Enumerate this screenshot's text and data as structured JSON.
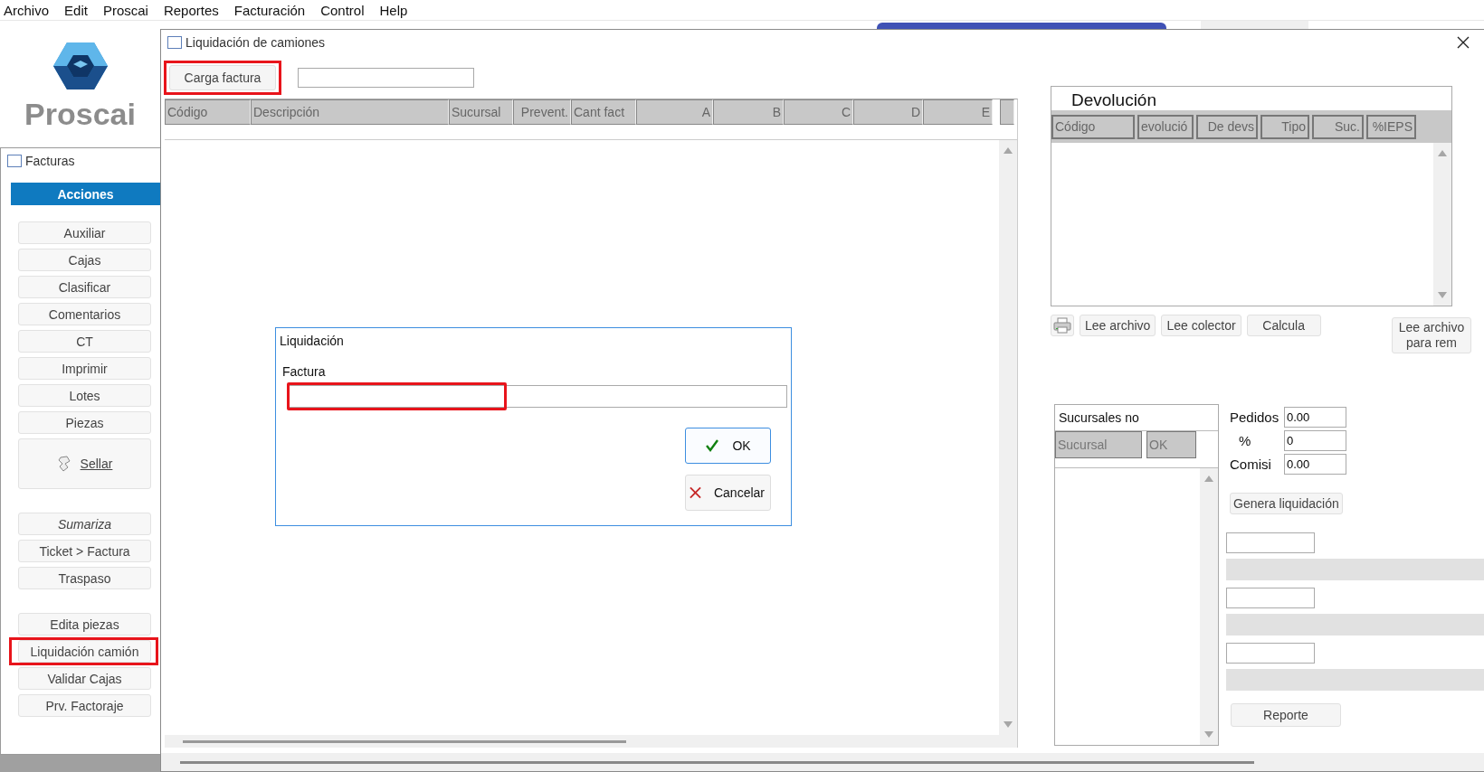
{
  "menu": [
    "Archivo",
    "Edit",
    "Proscai",
    "Reportes",
    "Facturación",
    "Control",
    "Help"
  ],
  "logo": {
    "text": "Proscai"
  },
  "sidebar": {
    "title": "Facturas",
    "section": "Acciones",
    "groups": [
      [
        {
          "label": "Auxiliar",
          "kind": "plain",
          "highlighted": false
        },
        {
          "label": "Cajas",
          "kind": "plain",
          "highlighted": false
        },
        {
          "label": "Clasificar",
          "kind": "plain",
          "highlighted": false
        },
        {
          "label": "Comentarios",
          "kind": "plain",
          "highlighted": false
        },
        {
          "label": "CT",
          "kind": "plain",
          "highlighted": false
        },
        {
          "label": "Imprimir",
          "kind": "plain",
          "highlighted": false
        },
        {
          "label": "Lotes",
          "kind": "plain",
          "highlighted": false
        },
        {
          "label": "Piezas",
          "kind": "plain",
          "highlighted": false
        },
        {
          "label": "Sellar",
          "kind": "tall",
          "highlighted": false
        }
      ],
      [
        {
          "label": "Sumariza",
          "kind": "italic",
          "highlighted": false
        },
        {
          "label": "Ticket > Factura",
          "kind": "plain",
          "highlighted": false
        },
        {
          "label": "Traspaso",
          "kind": "plain",
          "highlighted": false
        }
      ],
      [
        {
          "label": "Edita piezas",
          "kind": "plain",
          "highlighted": false
        },
        {
          "label": "Liquidación camión",
          "kind": "plain",
          "highlighted": true
        },
        {
          "label": "Validar Cajas",
          "kind": "plain",
          "highlighted": false
        },
        {
          "label": "Prv. Factoraje",
          "kind": "plain",
          "highlighted": false
        }
      ]
    ]
  },
  "window": {
    "title": "Liquidación de camiones",
    "load_button": {
      "label": "Carga factura",
      "highlighted": true
    },
    "table": {
      "columns": [
        {
          "label": "Código",
          "right_aligned": false
        },
        {
          "label": "Descripción",
          "right_aligned": false
        },
        {
          "label": "Sucursal",
          "right_aligned": false
        },
        {
          "label": "Prevent.",
          "right_aligned": true
        },
        {
          "label": "Cant fact",
          "right_aligned": false
        },
        {
          "label": "A",
          "right_aligned": true
        },
        {
          "label": "B",
          "right_aligned": true
        },
        {
          "label": "C",
          "right_aligned": true
        },
        {
          "label": "D",
          "right_aligned": true
        },
        {
          "label": "E",
          "right_aligned": true
        }
      ]
    }
  },
  "devolucion": {
    "title": "Devolución",
    "columns": [
      {
        "label": "Código",
        "right_aligned": false
      },
      {
        "label": "evolució",
        "right_aligned": false
      },
      {
        "label": "De devs",
        "right_aligned": true
      },
      {
        "label": "Tipo",
        "right_aligned": true
      },
      {
        "label": "Suc.",
        "right_aligned": true
      },
      {
        "label": "%IEPS",
        "right_aligned": true
      }
    ],
    "buttons": [
      {
        "kind": "print"
      },
      {
        "kind": "text",
        "label": "Lee archivo"
      },
      {
        "kind": "text",
        "label": "Lee colector"
      },
      {
        "kind": "text",
        "label": "Calcula"
      },
      {
        "kind": "side",
        "label": "Lee archivo para rem"
      }
    ]
  },
  "sucursales": {
    "title": "Sucursales no",
    "columns": [
      "Sucursal",
      "OK"
    ]
  },
  "totals": [
    {
      "label": "Pedidos",
      "value": "0.00"
    },
    {
      "label": "%",
      "value": "0"
    },
    {
      "label": "Comisi",
      "value": "0.00"
    }
  ],
  "generate_button": "Genera liquidación",
  "report_button": "Reporte",
  "dialog": {
    "title": "Liquidación",
    "field_label": "Factura",
    "field_highlighted": true,
    "buttons": [
      {
        "label": "OK",
        "kind": "ok"
      },
      {
        "label": "Cancelar",
        "kind": "cancel"
      }
    ]
  }
}
